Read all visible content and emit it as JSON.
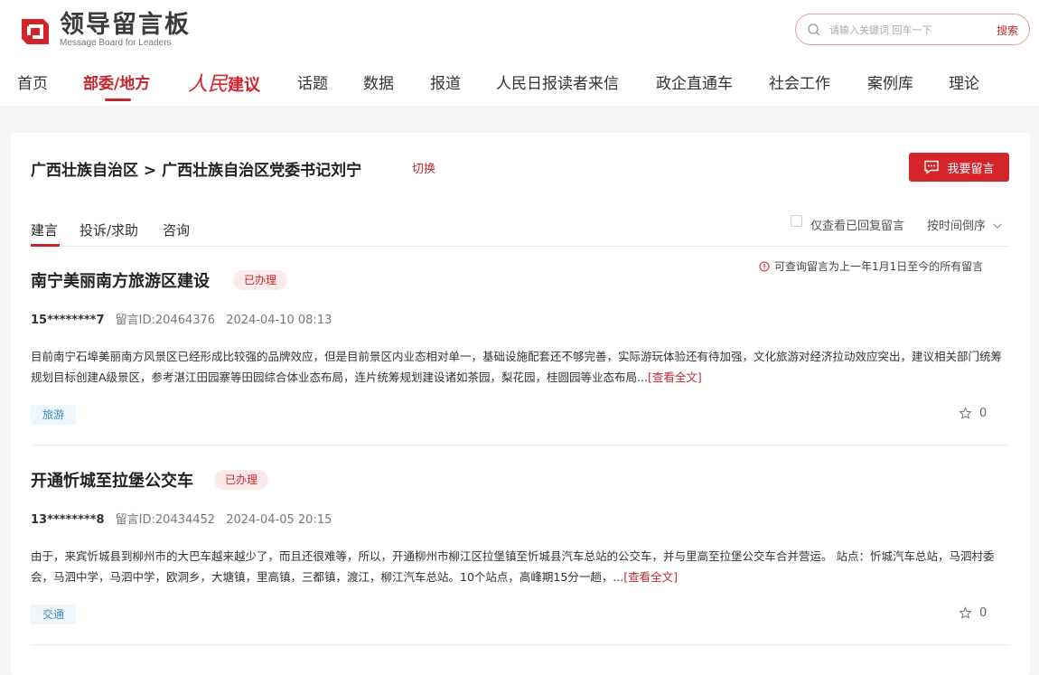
{
  "brand": {
    "title": "领导留言板",
    "subtitle": "Message Board for Leaders",
    "color": "#c0282e"
  },
  "search": {
    "placeholder": "请输入关键词 回车一下",
    "button_label": "搜索"
  },
  "nav": {
    "items": [
      "首页",
      "部委/地方",
      "建议",
      "话题",
      "数据",
      "报道",
      "人民日报读者来信",
      "政企直通车",
      "社会工作",
      "案例库",
      "理论"
    ],
    "renmin_logo_text": "人民",
    "active_index": 1
  },
  "page": {
    "breadcrumb": "广西壮族自治区 > 广西壮族自治区党委书记刘宁",
    "switch_label": "切换",
    "post_button_label": "我要留言"
  },
  "tabs": [
    {
      "label": "建言",
      "active": true
    },
    {
      "label": "投诉/求助",
      "active": false
    },
    {
      "label": "咨询",
      "active": false
    }
  ],
  "filters": {
    "only_replied_label": "仅查看已回复留言",
    "only_replied_checked": false,
    "sort_label": "按时间倒序"
  },
  "notice": "可查询留言为上一年1月1日至今的所有留言",
  "posts": [
    {
      "title": "南宁美丽南方旅游区建设",
      "status": "已办理",
      "user": "15********7",
      "id_label": "留言ID:20464376",
      "time": "2024-04-10 08:13",
      "content": "目前南宁石埠美丽南方风景区已经形成比较强的品牌效应，但是目前景区内业态相对单一，基础设施配套还不够完善，实际游玩体验还有待加强，文化旅游对经济拉动效应突出，建议相关部门统筹规划目标创建A级景区，参考湛江田园寨等田园综合体业态布局，连片统筹规划建设诸如茶园，梨花园，桂圆园等业态布局...",
      "more_label": "[查看全文]",
      "tag": "旅游",
      "favorites": "0"
    },
    {
      "title": "开通忻城至拉堡公交车",
      "status": "已办理",
      "user": "13********8",
      "id_label": "留言ID:20434452",
      "time": "2024-04-05 20:15",
      "content": "由于，来宾忻城县到柳州市的大巴车越来越少了，而且还很难等，所以，开通柳州市柳江区拉堡镇至忻城县汽车总站的公交车，并与里高至拉堡公交车合并营运。 站点：忻城汽车总站，马泗村委会，马泗中学，马泗中学，欧洞乡，大塘镇，里高镇，三都镇，渡江，柳江汽车总站。10个站点，高峰期15分一趟，...",
      "more_label": "[查看全文]",
      "tag": "交通",
      "favorites": "0"
    }
  ]
}
